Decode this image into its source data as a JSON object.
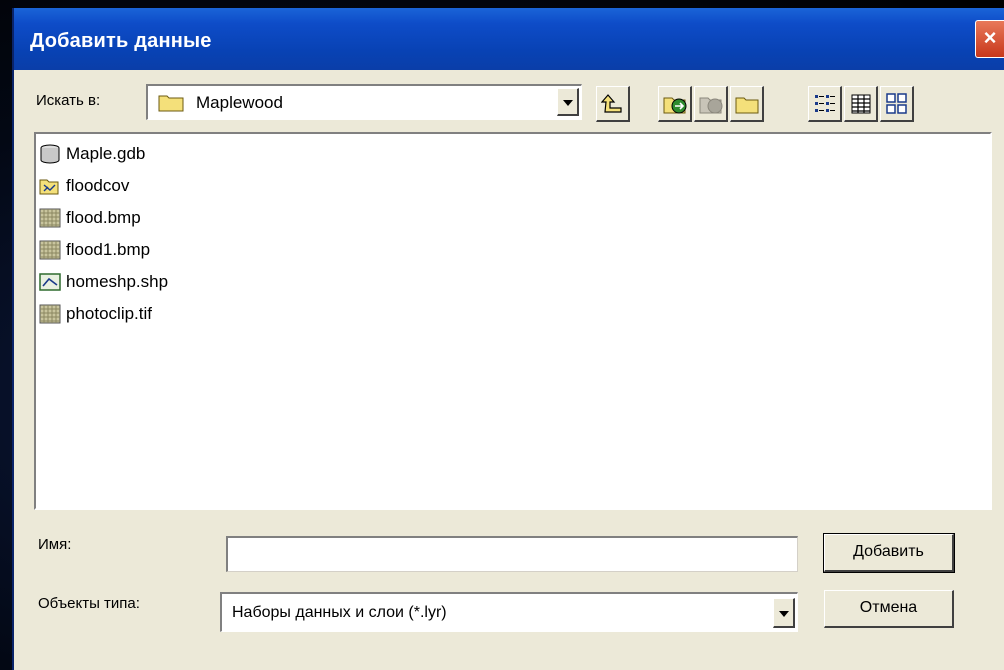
{
  "dialog": {
    "title": "Добавить данные",
    "close_label": "×"
  },
  "look_in": {
    "label": "Искать в:",
    "value": "Maplewood"
  },
  "toolbar": {
    "buttons": [
      "up-one-level",
      "connect-to-folder",
      "disconnect-folder",
      "new-folder",
      "list-view",
      "details-view",
      "thumbnails-view"
    ]
  },
  "files": [
    {
      "name": "Maple.gdb",
      "icon": "geodatabase-icon"
    },
    {
      "name": "floodcov",
      "icon": "coverage-icon"
    },
    {
      "name": "flood.bmp",
      "icon": "raster-icon"
    },
    {
      "name": "flood1.bmp",
      "icon": "raster-icon"
    },
    {
      "name": "homeshp.shp",
      "icon": "shapefile-icon"
    },
    {
      "name": "photoclip.tif",
      "icon": "raster-icon"
    }
  ],
  "name_field": {
    "label": "Имя:",
    "value": ""
  },
  "type_field": {
    "label": "Объекты типа:",
    "value": "Наборы данных и слои (*.lyr)"
  },
  "buttons": {
    "add": "Добавить",
    "cancel": "Отмена"
  },
  "colors": {
    "titlebar": "#0a3ea8",
    "dialog_bg": "#ece9d8",
    "close": "#c8371b"
  }
}
